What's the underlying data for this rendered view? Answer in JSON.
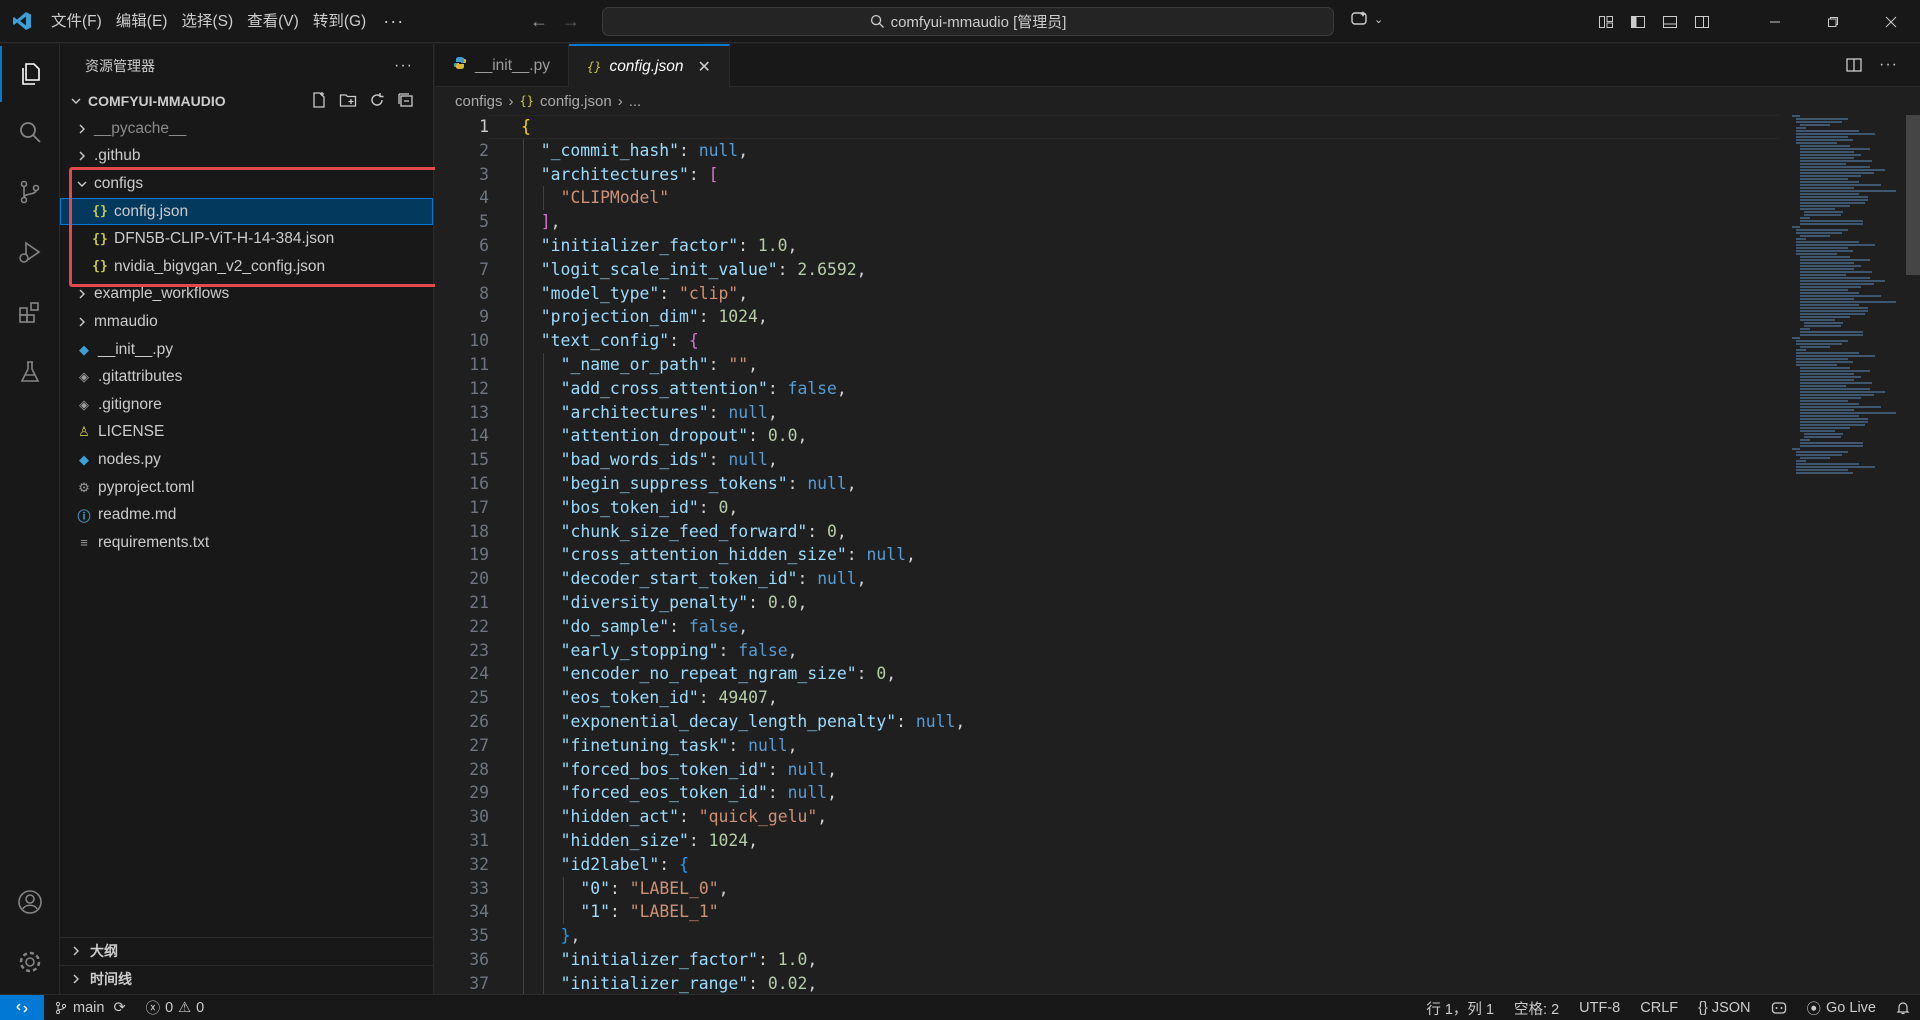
{
  "titlebar": {
    "menu": [
      "文件(F)",
      "编辑(E)",
      "选择(S)",
      "查看(V)",
      "转到(G)"
    ],
    "more": "···",
    "search_text": "comfyui-mmaudio [管理员]"
  },
  "explorer": {
    "title": "资源管理器",
    "more": "···",
    "project": "COMFYUI-MMAUDIO",
    "tree": [
      {
        "label": "__pycache__",
        "kind": "folder",
        "expanded": false,
        "depth": 0,
        "dim": true
      },
      {
        "label": ".github",
        "kind": "folder",
        "expanded": false,
        "depth": 0
      },
      {
        "label": "configs",
        "kind": "folder",
        "expanded": true,
        "depth": 0
      },
      {
        "label": "config.json",
        "kind": "json",
        "depth": 1,
        "selected": true
      },
      {
        "label": "DFN5B-CLIP-ViT-H-14-384.json",
        "kind": "json",
        "depth": 1
      },
      {
        "label": "nvidia_bigvgan_v2_config.json",
        "kind": "json",
        "depth": 1
      },
      {
        "label": "example_workflows",
        "kind": "folder",
        "expanded": false,
        "depth": 0
      },
      {
        "label": "mmaudio",
        "kind": "folder",
        "expanded": false,
        "depth": 0
      },
      {
        "label": "__init__.py",
        "kind": "python",
        "depth": 0
      },
      {
        "label": ".gitattributes",
        "kind": "git",
        "depth": 0
      },
      {
        "label": ".gitignore",
        "kind": "git",
        "depth": 0
      },
      {
        "label": "LICENSE",
        "kind": "license",
        "depth": 0
      },
      {
        "label": "nodes.py",
        "kind": "python",
        "depth": 0
      },
      {
        "label": "pyproject.toml",
        "kind": "gear",
        "depth": 0
      },
      {
        "label": "readme.md",
        "kind": "info",
        "depth": 0
      },
      {
        "label": "requirements.txt",
        "kind": "text",
        "depth": 0
      }
    ],
    "outline": "大纲",
    "timeline": "时间线"
  },
  "tabs": [
    {
      "label": "__init__.py",
      "icon": "python-icon",
      "active": false
    },
    {
      "label": "config.json",
      "icon": "json-icon",
      "active": true,
      "close": "✕"
    }
  ],
  "breadcrumb": {
    "folder": "configs",
    "file": "config.json",
    "more": "..."
  },
  "code_lines": [
    {
      "n": 1,
      "i": 0,
      "t": [
        [
          "{",
          "b1"
        ]
      ]
    },
    {
      "n": 2,
      "i": 1,
      "t": [
        [
          "\"_commit_hash\"",
          "k"
        ],
        [
          ": ",
          "p"
        ],
        [
          "null",
          "kw"
        ],
        [
          ",",
          "p"
        ]
      ]
    },
    {
      "n": 3,
      "i": 1,
      "t": [
        [
          "\"architectures\"",
          "k"
        ],
        [
          ": ",
          "p"
        ],
        [
          "[",
          "b2"
        ]
      ]
    },
    {
      "n": 4,
      "i": 2,
      "t": [
        [
          "\"CLIPModel\"",
          "s"
        ]
      ]
    },
    {
      "n": 5,
      "i": 1,
      "t": [
        [
          "]",
          "b2"
        ],
        [
          ",",
          "p"
        ]
      ]
    },
    {
      "n": 6,
      "i": 1,
      "t": [
        [
          "\"initializer_factor\"",
          "k"
        ],
        [
          ": ",
          "p"
        ],
        [
          "1.0",
          "n"
        ],
        [
          ",",
          "p"
        ]
      ]
    },
    {
      "n": 7,
      "i": 1,
      "t": [
        [
          "\"logit_scale_init_value\"",
          "k"
        ],
        [
          ": ",
          "p"
        ],
        [
          "2.6592",
          "n"
        ],
        [
          ",",
          "p"
        ]
      ]
    },
    {
      "n": 8,
      "i": 1,
      "t": [
        [
          "\"model_type\"",
          "k"
        ],
        [
          ": ",
          "p"
        ],
        [
          "\"clip\"",
          "s"
        ],
        [
          ",",
          "p"
        ]
      ]
    },
    {
      "n": 9,
      "i": 1,
      "t": [
        [
          "\"projection_dim\"",
          "k"
        ],
        [
          ": ",
          "p"
        ],
        [
          "1024",
          "n"
        ],
        [
          ",",
          "p"
        ]
      ]
    },
    {
      "n": 10,
      "i": 1,
      "t": [
        [
          "\"text_config\"",
          "k"
        ],
        [
          ": ",
          "p"
        ],
        [
          "{",
          "b2"
        ]
      ]
    },
    {
      "n": 11,
      "i": 2,
      "t": [
        [
          "\"_name_or_path\"",
          "k"
        ],
        [
          ": ",
          "p"
        ],
        [
          "\"\"",
          "s"
        ],
        [
          ",",
          "p"
        ]
      ]
    },
    {
      "n": 12,
      "i": 2,
      "t": [
        [
          "\"add_cross_attention\"",
          "k"
        ],
        [
          ": ",
          "p"
        ],
        [
          "false",
          "kw"
        ],
        [
          ",",
          "p"
        ]
      ]
    },
    {
      "n": 13,
      "i": 2,
      "t": [
        [
          "\"architectures\"",
          "k"
        ],
        [
          ": ",
          "p"
        ],
        [
          "null",
          "kw"
        ],
        [
          ",",
          "p"
        ]
      ]
    },
    {
      "n": 14,
      "i": 2,
      "t": [
        [
          "\"attention_dropout\"",
          "k"
        ],
        [
          ": ",
          "p"
        ],
        [
          "0.0",
          "n"
        ],
        [
          ",",
          "p"
        ]
      ]
    },
    {
      "n": 15,
      "i": 2,
      "t": [
        [
          "\"bad_words_ids\"",
          "k"
        ],
        [
          ": ",
          "p"
        ],
        [
          "null",
          "kw"
        ],
        [
          ",",
          "p"
        ]
      ]
    },
    {
      "n": 16,
      "i": 2,
      "t": [
        [
          "\"begin_suppress_tokens\"",
          "k"
        ],
        [
          ": ",
          "p"
        ],
        [
          "null",
          "kw"
        ],
        [
          ",",
          "p"
        ]
      ]
    },
    {
      "n": 17,
      "i": 2,
      "t": [
        [
          "\"bos_token_id\"",
          "k"
        ],
        [
          ": ",
          "p"
        ],
        [
          "0",
          "n"
        ],
        [
          ",",
          "p"
        ]
      ]
    },
    {
      "n": 18,
      "i": 2,
      "t": [
        [
          "\"chunk_size_feed_forward\"",
          "k"
        ],
        [
          ": ",
          "p"
        ],
        [
          "0",
          "n"
        ],
        [
          ",",
          "p"
        ]
      ]
    },
    {
      "n": 19,
      "i": 2,
      "t": [
        [
          "\"cross_attention_hidden_size\"",
          "k"
        ],
        [
          ": ",
          "p"
        ],
        [
          "null",
          "kw"
        ],
        [
          ",",
          "p"
        ]
      ]
    },
    {
      "n": 20,
      "i": 2,
      "t": [
        [
          "\"decoder_start_token_id\"",
          "k"
        ],
        [
          ": ",
          "p"
        ],
        [
          "null",
          "kw"
        ],
        [
          ",",
          "p"
        ]
      ]
    },
    {
      "n": 21,
      "i": 2,
      "t": [
        [
          "\"diversity_penalty\"",
          "k"
        ],
        [
          ": ",
          "p"
        ],
        [
          "0.0",
          "n"
        ],
        [
          ",",
          "p"
        ]
      ]
    },
    {
      "n": 22,
      "i": 2,
      "t": [
        [
          "\"do_sample\"",
          "k"
        ],
        [
          ": ",
          "p"
        ],
        [
          "false",
          "kw"
        ],
        [
          ",",
          "p"
        ]
      ]
    },
    {
      "n": 23,
      "i": 2,
      "t": [
        [
          "\"early_stopping\"",
          "k"
        ],
        [
          ": ",
          "p"
        ],
        [
          "false",
          "kw"
        ],
        [
          ",",
          "p"
        ]
      ]
    },
    {
      "n": 24,
      "i": 2,
      "t": [
        [
          "\"encoder_no_repeat_ngram_size\"",
          "k"
        ],
        [
          ": ",
          "p"
        ],
        [
          "0",
          "n"
        ],
        [
          ",",
          "p"
        ]
      ]
    },
    {
      "n": 25,
      "i": 2,
      "t": [
        [
          "\"eos_token_id\"",
          "k"
        ],
        [
          ": ",
          "p"
        ],
        [
          "49407",
          "n"
        ],
        [
          ",",
          "p"
        ]
      ]
    },
    {
      "n": 26,
      "i": 2,
      "t": [
        [
          "\"exponential_decay_length_penalty\"",
          "k"
        ],
        [
          ": ",
          "p"
        ],
        [
          "null",
          "kw"
        ],
        [
          ",",
          "p"
        ]
      ]
    },
    {
      "n": 27,
      "i": 2,
      "t": [
        [
          "\"finetuning_task\"",
          "k"
        ],
        [
          ": ",
          "p"
        ],
        [
          "null",
          "kw"
        ],
        [
          ",",
          "p"
        ]
      ]
    },
    {
      "n": 28,
      "i": 2,
      "t": [
        [
          "\"forced_bos_token_id\"",
          "k"
        ],
        [
          ": ",
          "p"
        ],
        [
          "null",
          "kw"
        ],
        [
          ",",
          "p"
        ]
      ]
    },
    {
      "n": 29,
      "i": 2,
      "t": [
        [
          "\"forced_eos_token_id\"",
          "k"
        ],
        [
          ": ",
          "p"
        ],
        [
          "null",
          "kw"
        ],
        [
          ",",
          "p"
        ]
      ]
    },
    {
      "n": 30,
      "i": 2,
      "t": [
        [
          "\"hidden_act\"",
          "k"
        ],
        [
          ": ",
          "p"
        ],
        [
          "\"quick_gelu\"",
          "s"
        ],
        [
          ",",
          "p"
        ]
      ]
    },
    {
      "n": 31,
      "i": 2,
      "t": [
        [
          "\"hidden_size\"",
          "k"
        ],
        [
          ": ",
          "p"
        ],
        [
          "1024",
          "n"
        ],
        [
          ",",
          "p"
        ]
      ]
    },
    {
      "n": 32,
      "i": 2,
      "t": [
        [
          "\"id2label\"",
          "k"
        ],
        [
          ": ",
          "p"
        ],
        [
          "{",
          "b3"
        ]
      ]
    },
    {
      "n": 33,
      "i": 3,
      "t": [
        [
          "\"0\"",
          "k"
        ],
        [
          ": ",
          "p"
        ],
        [
          "\"LABEL_0\"",
          "s"
        ],
        [
          ",",
          "p"
        ]
      ]
    },
    {
      "n": 34,
      "i": 3,
      "t": [
        [
          "\"1\"",
          "k"
        ],
        [
          ": ",
          "p"
        ],
        [
          "\"LABEL_1\"",
          "s"
        ]
      ]
    },
    {
      "n": 35,
      "i": 2,
      "t": [
        [
          "}",
          "b3"
        ],
        [
          ",",
          "p"
        ]
      ]
    },
    {
      "n": 36,
      "i": 2,
      "t": [
        [
          "\"initializer_factor\"",
          "k"
        ],
        [
          ": ",
          "p"
        ],
        [
          "1.0",
          "n"
        ],
        [
          ",",
          "p"
        ]
      ]
    },
    {
      "n": 37,
      "i": 2,
      "t": [
        [
          "\"initializer_range\"",
          "k"
        ],
        [
          ": ",
          "p"
        ],
        [
          "0.02",
          "n"
        ],
        [
          ",",
          "p"
        ]
      ]
    }
  ],
  "status": {
    "branch": "main",
    "errors": "0",
    "warnings": "0",
    "position": "行 1，列 1",
    "spaces": "空格: 2",
    "encoding": "UTF-8",
    "eol": "CRLF",
    "language": "{} JSON",
    "golive": "Go Live"
  },
  "colors": {
    "accent": "#0078d4",
    "highlight_box": "#e5484d"
  }
}
